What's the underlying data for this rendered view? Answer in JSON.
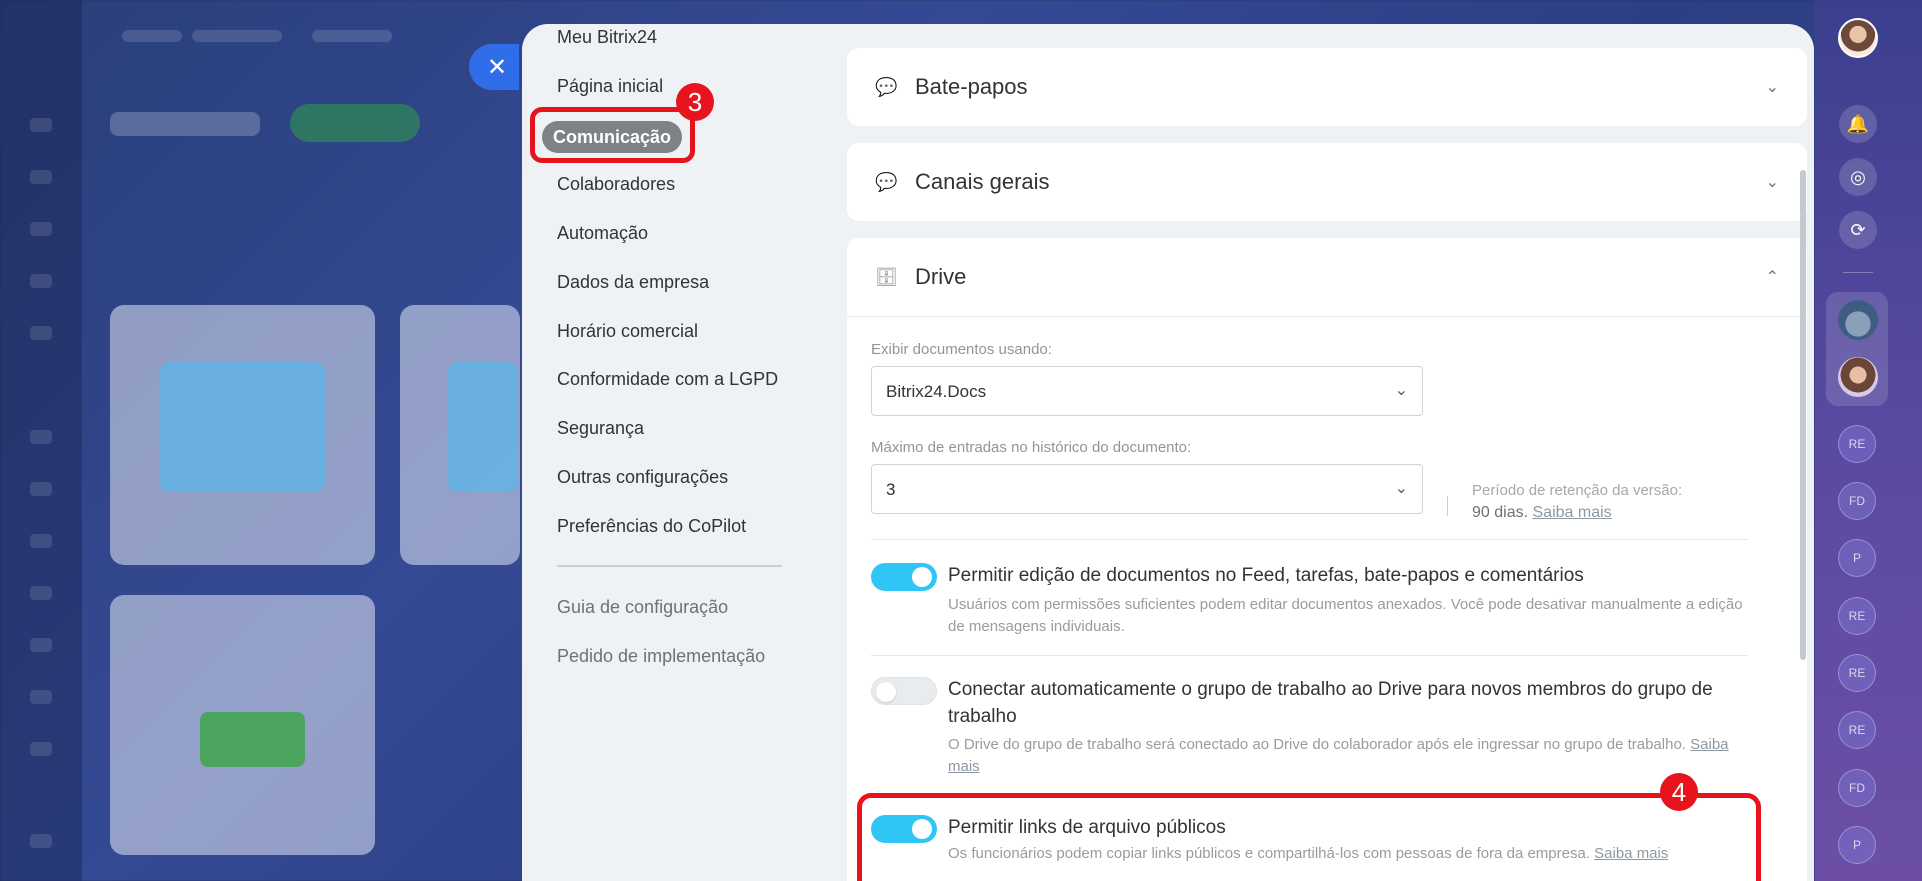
{
  "nav": {
    "items": [
      "Meu Bitrix24",
      "Página inicial",
      "Comunicação",
      "Colaboradores",
      "Automação",
      "Dados da empresa",
      "Horário comercial",
      "Conformidade com a LGPD",
      "Segurança",
      "Outras configurações",
      "Preferências do CoPilot"
    ],
    "active": "Comunicação",
    "footer": [
      "Guia de configuração",
      "Pedido de implementação"
    ]
  },
  "callouts": {
    "step3": "3",
    "step4": "4"
  },
  "sections": {
    "chats": {
      "title": "Bate-papos",
      "icon": "chat-bubbles-icon"
    },
    "channels": {
      "title": "Canais gerais",
      "icon": "chat-bubbles-icon"
    },
    "drive": {
      "title": "Drive",
      "icon": "drive-icon"
    }
  },
  "drive": {
    "docs_label": "Exibir documentos usando:",
    "docs_value": "Bitrix24.Docs",
    "history_label": "Máximo de entradas no histórico do documento:",
    "history_value": "3",
    "retention_label": "Período de retenção da versão:",
    "retention_value": "90 dias.",
    "learn_more": "Saiba mais",
    "options": [
      {
        "title": "Permitir edição de documentos no Feed, tarefas, bate-papos e comentários",
        "desc": "Usuários com permissões suficientes podem editar documentos anexados. Você pode desativar manualmente a edição de mensagens individuais.",
        "enabled": true
      },
      {
        "title": "Conectar automaticamente o grupo de trabalho ao Drive para novos membros do grupo de trabalho",
        "desc": "O Drive do grupo de trabalho será conectado ao Drive do colaborador após ele ingressar no grupo de trabalho.",
        "link": "Saiba mais",
        "enabled": false
      },
      {
        "title": "Permitir links de arquivo públicos",
        "desc": "Os funcionários podem copiar links públicos e compartilhá-los com pessoas de fora da empresa.",
        "link": "Saiba mais",
        "enabled": true
      }
    ]
  },
  "rail": {
    "badges": [
      "RE",
      "FD",
      "P",
      "RE",
      "RE",
      "RE",
      "FD",
      "P"
    ]
  },
  "colors": {
    "accent": "#2fc6f6",
    "highlight": "#e8141d",
    "close": "#2f6ee8"
  }
}
